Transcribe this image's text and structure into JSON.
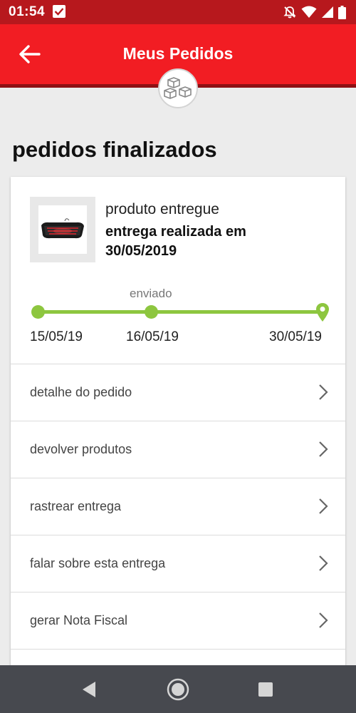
{
  "status_bar": {
    "time": "01:54",
    "icons": [
      "checkbox-notification-icon",
      "notifications-off-icon",
      "wifi-icon",
      "signal-icon",
      "battery-icon"
    ]
  },
  "header": {
    "title": "Meus Pedidos",
    "back_icon": "arrow-left-icon",
    "badge_icon": "boxes-icon",
    "colors": {
      "app_bar": "#f21d23",
      "status_bar": "#b7181d"
    }
  },
  "section": {
    "title": "pedidos finalizados"
  },
  "order": {
    "product_image": "keyboard-image",
    "status": "produto entregue",
    "delivery_text": "entrega realizada em 30/05/2019",
    "timeline": {
      "accent_color": "#8dc63f",
      "step_label": "enviado",
      "progress": 1.0,
      "dates": [
        "15/05/19",
        "16/05/19",
        "30/05/19"
      ]
    }
  },
  "menu": {
    "items": [
      {
        "label": "detalhe do pedido"
      },
      {
        "label": "devolver produtos"
      },
      {
        "label": "rastrear entrega"
      },
      {
        "label": "falar sobre esta entrega"
      },
      {
        "label": "gerar Nota Fiscal"
      }
    ]
  },
  "nav_bar": {
    "buttons": [
      "back-triangle-icon",
      "home-circle-icon",
      "recents-square-icon"
    ]
  }
}
